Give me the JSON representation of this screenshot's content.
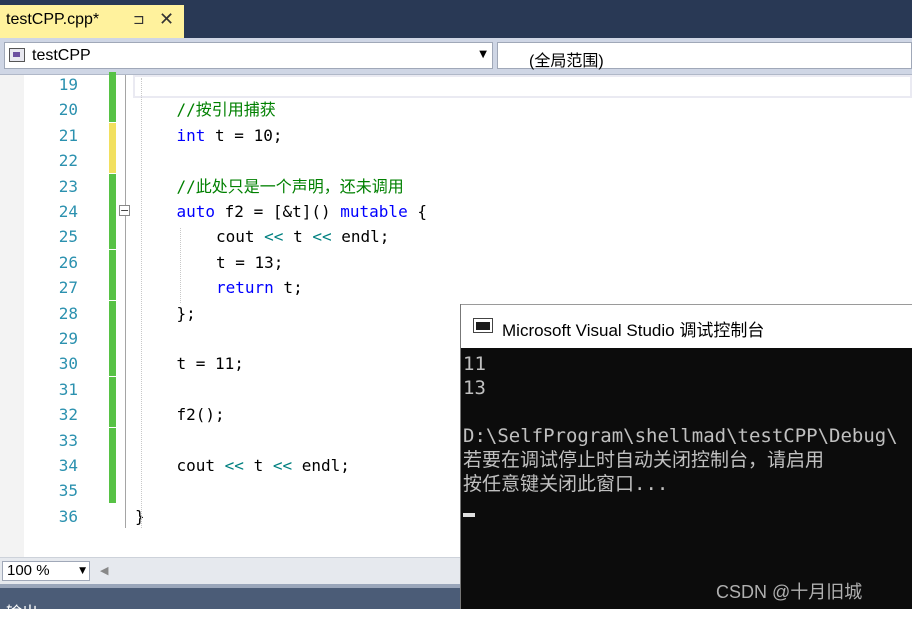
{
  "tab": {
    "title": "testCPP.cpp*",
    "pin_icon": "pin-icon",
    "close_icon": "close-icon"
  },
  "nav": {
    "project": "testCPP",
    "scope": "(全局范围)"
  },
  "code_lines": [
    {
      "n": "19",
      "text": ""
    },
    {
      "n": "20",
      "text": "//按引用捕获"
    },
    {
      "n": "21",
      "text": "int t = 10;"
    },
    {
      "n": "22",
      "text": ""
    },
    {
      "n": "23",
      "text": "//此处只是一个声明，还未调用"
    },
    {
      "n": "24",
      "text": "auto f2 = [&t]() mutable {"
    },
    {
      "n": "25",
      "text": "cout << t << endl;"
    },
    {
      "n": "26",
      "text": "t = 13;"
    },
    {
      "n": "27",
      "text": "return t;"
    },
    {
      "n": "28",
      "text": "};"
    },
    {
      "n": "29",
      "text": ""
    },
    {
      "n": "30",
      "text": "t = 11;"
    },
    {
      "n": "31",
      "text": ""
    },
    {
      "n": "32",
      "text": "f2();"
    },
    {
      "n": "33",
      "text": ""
    },
    {
      "n": "34",
      "text": "cout << t << endl;"
    },
    {
      "n": "35",
      "text": ""
    },
    {
      "n": "36",
      "text": "}"
    }
  ],
  "zoom": "100 %",
  "output_label": "输出",
  "console": {
    "title": "Microsoft Visual Studio 调试控制台",
    "lines": [
      "11",
      "13",
      "",
      "D:\\SelfProgram\\shellmad\\testCPP\\Debug\\",
      "若要在调试停止时自动关闭控制台，请启用",
      "按任意键关闭此窗口..."
    ]
  },
  "watermark": "CSDN @十月旧城",
  "colors": {
    "tab_active": "#fff29d",
    "tab_strip": "#293955",
    "keyword": "#0000ff",
    "comment": "#008000",
    "line_number": "#2b91af",
    "change_saved": "#57c245",
    "change_unsaved": "#f2e05f",
    "console_bg": "#0c0c0c"
  }
}
